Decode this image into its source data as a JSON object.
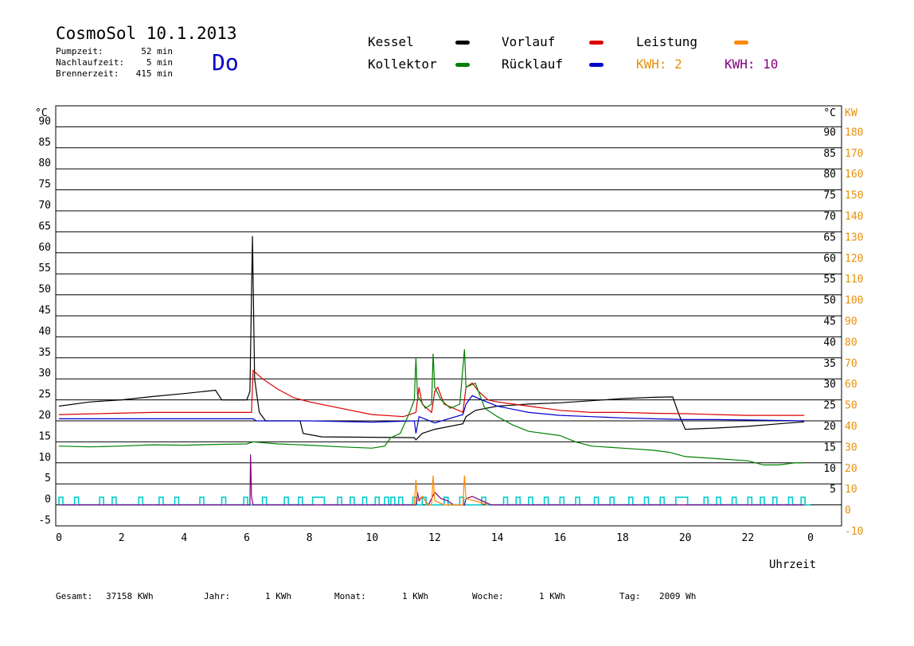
{
  "header": {
    "title": "CosmoSol 10.1.2013",
    "day": "Do",
    "stats": [
      {
        "label": "Pumpzeit:",
        "value": "52 min"
      },
      {
        "label": "Nachlaufzeit:",
        "value": "5 min"
      },
      {
        "label": "Brennerzeit:",
        "value": "415 min"
      }
    ]
  },
  "legend": [
    {
      "label": "Kessel",
      "color": "#000000",
      "marker": true
    },
    {
      "label": "Vorlauf",
      "color": "#dd0000",
      "marker": true
    },
    {
      "label": "Leistung",
      "color": "#ff8800",
      "marker": true
    },
    {
      "label": "Kollektor",
      "color": "#008000",
      "marker": true
    },
    {
      "label": "Rücklauf",
      "color": "#0000cc",
      "marker": true
    },
    {
      "label": "KWH: 2",
      "color": "#e8900a",
      "marker": false
    },
    {
      "label": "KWH: 10",
      "color": "#800080",
      "marker": false
    }
  ],
  "footer": [
    {
      "label": "Gesamt:",
      "value": "37158 KWh"
    },
    {
      "label": "Jahr:",
      "value": "1 KWh"
    },
    {
      "label": "Monat:",
      "value": "1 KWh"
    },
    {
      "label": "Woche:",
      "value": "1 KWh"
    },
    {
      "label": "Tag:",
      "value": "2009 Wh"
    }
  ],
  "chart_data": {
    "type": "line",
    "xlabel": "Uhrzeit",
    "ylabel_left": "°C",
    "ylabel_right_1": "°C",
    "ylabel_right_2": "KW",
    "xlim": [
      0,
      24
    ],
    "ylim": [
      -5,
      95
    ],
    "x_ticks": [
      0,
      2,
      4,
      6,
      8,
      10,
      12,
      14,
      16,
      18,
      20,
      22,
      0
    ],
    "y_ticks_left": [
      -5,
      0,
      5,
      10,
      15,
      20,
      25,
      30,
      35,
      40,
      45,
      50,
      55,
      60,
      65,
      70,
      75,
      80,
      85,
      90
    ],
    "y_ticks_right_c": [
      5,
      10,
      15,
      20,
      25,
      30,
      35,
      40,
      45,
      50,
      55,
      60,
      65,
      70,
      75,
      80,
      85,
      90
    ],
    "y_ticks_right_kw": [
      -10,
      0,
      10,
      20,
      30,
      40,
      50,
      60,
      70,
      80,
      90,
      100,
      110,
      120,
      130,
      140,
      150,
      160,
      170,
      180
    ],
    "grid": true,
    "colors": {
      "grid": "#000000",
      "axis_right_kw": "#e8900a",
      "pump": "#00cccc"
    },
    "series": [
      {
        "name": "Kessel",
        "color": "#000000",
        "points": [
          [
            0,
            23.5
          ],
          [
            1,
            24.5
          ],
          [
            2,
            25
          ],
          [
            3,
            25.8
          ],
          [
            4,
            26.5
          ],
          [
            5,
            27.3
          ],
          [
            5.2,
            25
          ],
          [
            6,
            25
          ],
          [
            6.1,
            27
          ],
          [
            6.18,
            64
          ],
          [
            6.25,
            30
          ],
          [
            6.4,
            22
          ],
          [
            6.6,
            20
          ],
          [
            7,
            20
          ],
          [
            7.7,
            20
          ],
          [
            7.8,
            17
          ],
          [
            8.4,
            16.2
          ],
          [
            11.35,
            16
          ],
          [
            11.4,
            15.5
          ],
          [
            11.6,
            17
          ],
          [
            12,
            18
          ],
          [
            12.9,
            19.3
          ],
          [
            13,
            21
          ],
          [
            13.3,
            22.5
          ],
          [
            14,
            23.5
          ],
          [
            15,
            24
          ],
          [
            16,
            24.3
          ],
          [
            17,
            24.8
          ],
          [
            18,
            25.3
          ],
          [
            19,
            25.6
          ],
          [
            19.6,
            25.7
          ],
          [
            19.8,
            21.5
          ],
          [
            20,
            18
          ],
          [
            21,
            18.3
          ],
          [
            22,
            18.7
          ],
          [
            23,
            19.3
          ],
          [
            23.8,
            19.8
          ]
        ]
      },
      {
        "name": "Vorlauf",
        "color": "#dd0000",
        "points": [
          [
            0,
            21.5
          ],
          [
            3,
            22
          ],
          [
            5.5,
            22
          ],
          [
            6.15,
            22
          ],
          [
            6.2,
            32
          ],
          [
            6.5,
            30
          ],
          [
            7,
            27.5
          ],
          [
            7.5,
            25.5
          ],
          [
            8,
            24.5
          ],
          [
            9,
            23
          ],
          [
            10,
            21.5
          ],
          [
            11,
            21
          ],
          [
            11.4,
            22
          ],
          [
            11.5,
            28
          ],
          [
            11.6,
            24
          ],
          [
            11.9,
            22
          ],
          [
            12,
            27
          ],
          [
            12.1,
            28
          ],
          [
            12.3,
            24
          ],
          [
            12.6,
            23
          ],
          [
            12.9,
            22
          ],
          [
            13,
            28
          ],
          [
            13.2,
            29
          ],
          [
            13.4,
            27
          ],
          [
            13.7,
            25
          ],
          [
            14,
            24.5
          ],
          [
            15,
            23.5
          ],
          [
            16,
            22.5
          ],
          [
            17,
            22
          ],
          [
            18,
            22
          ],
          [
            19,
            21.8
          ],
          [
            20,
            21.7
          ],
          [
            21,
            21.5
          ],
          [
            22,
            21.3
          ],
          [
            23.8,
            21.3
          ]
        ]
      },
      {
        "name": "Rücklauf",
        "color": "#0000cc",
        "points": [
          [
            0,
            20.5
          ],
          [
            6.2,
            20.5
          ],
          [
            6.3,
            20
          ],
          [
            8,
            20
          ],
          [
            10,
            19.7
          ],
          [
            11.35,
            20
          ],
          [
            11.4,
            17
          ],
          [
            11.5,
            21
          ],
          [
            12,
            19.5
          ],
          [
            12.9,
            21.5
          ],
          [
            13,
            24
          ],
          [
            13.2,
            26
          ],
          [
            13.5,
            25
          ],
          [
            14,
            23.5
          ],
          [
            15,
            22
          ],
          [
            16,
            21.3
          ],
          [
            17,
            21
          ],
          [
            18,
            20.7
          ],
          [
            19,
            20.5
          ],
          [
            20,
            20.3
          ],
          [
            21,
            20.3
          ],
          [
            22,
            20.2
          ],
          [
            23.8,
            20
          ]
        ]
      },
      {
        "name": "Kollektor",
        "color": "#008000",
        "points": [
          [
            0,
            14
          ],
          [
            1,
            13.8
          ],
          [
            2,
            14
          ],
          [
            3,
            14.3
          ],
          [
            4,
            14.2
          ],
          [
            5,
            14.4
          ],
          [
            6,
            14.5
          ],
          [
            6.2,
            15
          ],
          [
            7,
            14.5
          ],
          [
            8,
            14.2
          ],
          [
            9,
            13.8
          ],
          [
            10,
            13.5
          ],
          [
            10.4,
            14
          ],
          [
            10.6,
            16
          ],
          [
            10.9,
            17
          ],
          [
            11.2,
            22
          ],
          [
            11.35,
            25
          ],
          [
            11.4,
            35
          ],
          [
            11.45,
            26
          ],
          [
            11.7,
            23
          ],
          [
            11.9,
            24
          ],
          [
            11.95,
            36
          ],
          [
            12,
            28
          ],
          [
            12.2,
            25
          ],
          [
            12.5,
            23
          ],
          [
            12.8,
            24
          ],
          [
            12.95,
            37
          ],
          [
            13,
            28
          ],
          [
            13.3,
            29
          ],
          [
            13.6,
            23
          ],
          [
            14,
            21
          ],
          [
            14.5,
            19
          ],
          [
            15,
            17.5
          ],
          [
            16,
            16.5
          ],
          [
            16.5,
            15
          ],
          [
            17,
            14
          ],
          [
            18,
            13.5
          ],
          [
            19,
            13
          ],
          [
            19.5,
            12.5
          ],
          [
            20,
            11.5
          ],
          [
            21,
            11
          ],
          [
            22,
            10.5
          ],
          [
            22.5,
            9.5
          ],
          [
            23,
            9.5
          ],
          [
            23.5,
            10
          ],
          [
            23.8,
            10
          ]
        ]
      },
      {
        "name": "KWH: 10",
        "color": "#800080",
        "points": [
          [
            0,
            0
          ],
          [
            6.1,
            0
          ],
          [
            6.12,
            12
          ],
          [
            6.15,
            2
          ],
          [
            6.2,
            0
          ],
          [
            11.4,
            0
          ],
          [
            11.45,
            3
          ],
          [
            11.5,
            1
          ],
          [
            11.6,
            2
          ],
          [
            11.8,
            0
          ],
          [
            12,
            3
          ],
          [
            12.2,
            1.5
          ],
          [
            12.4,
            1
          ],
          [
            12.6,
            0
          ],
          [
            12.95,
            0
          ],
          [
            13,
            1.5
          ],
          [
            13.2,
            2
          ],
          [
            13.5,
            1
          ],
          [
            13.8,
            0
          ],
          [
            23.8,
            0
          ]
        ]
      },
      {
        "name": "Leistung",
        "color": "#ff8800",
        "points": [
          [
            11.35,
            0
          ],
          [
            11.4,
            6
          ],
          [
            11.45,
            1
          ],
          [
            11.6,
            2
          ],
          [
            11.8,
            0
          ],
          [
            11.9,
            0
          ],
          [
            11.95,
            7
          ],
          [
            12,
            1
          ],
          [
            12.3,
            0
          ],
          [
            12.9,
            0
          ],
          [
            12.95,
            7
          ],
          [
            13,
            1.5
          ],
          [
            13.5,
            0.5
          ],
          [
            13.7,
            0
          ]
        ]
      }
    ],
    "pump_pulses": [
      [
        0,
        0.05
      ],
      [
        0.5,
        0.55
      ],
      [
        1.3,
        1.35
      ],
      [
        1.7,
        1.75
      ],
      [
        2.55,
        2.6
      ],
      [
        3.2,
        3.25
      ],
      [
        3.7,
        3.75
      ],
      [
        4.5,
        4.55
      ],
      [
        5.2,
        5.25
      ],
      [
        5.9,
        5.95
      ],
      [
        6.5,
        6.55
      ],
      [
        7.2,
        7.25
      ],
      [
        7.65,
        7.7
      ],
      [
        8.1,
        8.4
      ],
      [
        8.9,
        8.95
      ],
      [
        9.3,
        9.35
      ],
      [
        9.7,
        9.75
      ],
      [
        10.1,
        10.15
      ],
      [
        10.4,
        10.45
      ],
      [
        10.6,
        10.65
      ],
      [
        10.85,
        10.9
      ],
      [
        11.3,
        11.35
      ],
      [
        11.6,
        11.65
      ],
      [
        12.3,
        12.35
      ],
      [
        12.8,
        12.85
      ],
      [
        13.5,
        13.55
      ],
      [
        14.2,
        14.25
      ],
      [
        14.6,
        14.65
      ],
      [
        15,
        15.05
      ],
      [
        15.5,
        15.55
      ],
      [
        16,
        16.05
      ],
      [
        16.5,
        16.55
      ],
      [
        17.1,
        17.15
      ],
      [
        17.6,
        17.65
      ],
      [
        18.2,
        18.25
      ],
      [
        18.7,
        18.75
      ],
      [
        19.2,
        19.25
      ],
      [
        19.7,
        20
      ],
      [
        20.6,
        20.65
      ],
      [
        21,
        21.05
      ],
      [
        21.5,
        21.55
      ],
      [
        22,
        22.05
      ],
      [
        22.4,
        22.45
      ],
      [
        22.8,
        22.85
      ],
      [
        23.3,
        23.35
      ],
      [
        23.7,
        23.75
      ]
    ]
  }
}
